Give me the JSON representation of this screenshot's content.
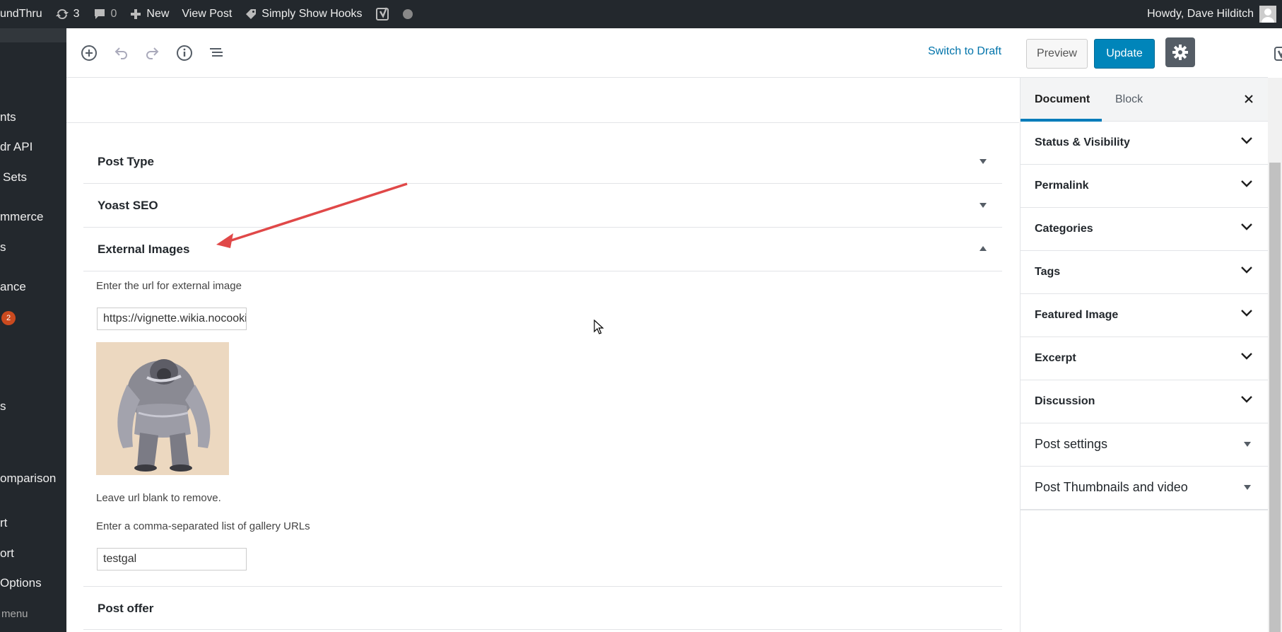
{
  "admin_bar": {
    "site_name": "undThru",
    "updates_count": "3",
    "comments_count": "0",
    "new_label": "New",
    "view_post_label": "View Post",
    "show_hooks_label": "Simply Show Hooks",
    "greeting": "Howdy, Dave Hilditch"
  },
  "admin_menu": {
    "items": [
      "nts",
      "dr API",
      "Sets",
      "mmerce",
      "s",
      "ance",
      "s",
      "omparison",
      "rt",
      "ort",
      "Options"
    ],
    "badge": "2",
    "collapse_label": "menu"
  },
  "toolbar": {
    "switch_to_draft": "Switch to Draft",
    "preview": "Preview",
    "update": "Update"
  },
  "panels": {
    "post_type": "Post Type",
    "yoast_seo": "Yoast SEO",
    "external_images": "External Images",
    "post_offer": "Post offer"
  },
  "external_images": {
    "url_label": "Enter the url for external image",
    "url_value": "https://vignette.wikia.nocookie.net",
    "remove_hint": "Leave url blank to remove.",
    "gallery_label": "Enter a comma-separated list of gallery URLs",
    "gallery_value": "testgal"
  },
  "sidebar": {
    "tabs": {
      "document": "Document",
      "block": "Block"
    },
    "panels": [
      "Status & Visibility",
      "Permalink",
      "Categories",
      "Tags",
      "Featured Image",
      "Excerpt",
      "Discussion",
      "Post settings",
      "Post Thumbnails and video"
    ]
  },
  "colors": {
    "admin_bg": "#23282d",
    "accent": "#0085ba",
    "link": "#0073aa",
    "arrow": "#e04848"
  }
}
